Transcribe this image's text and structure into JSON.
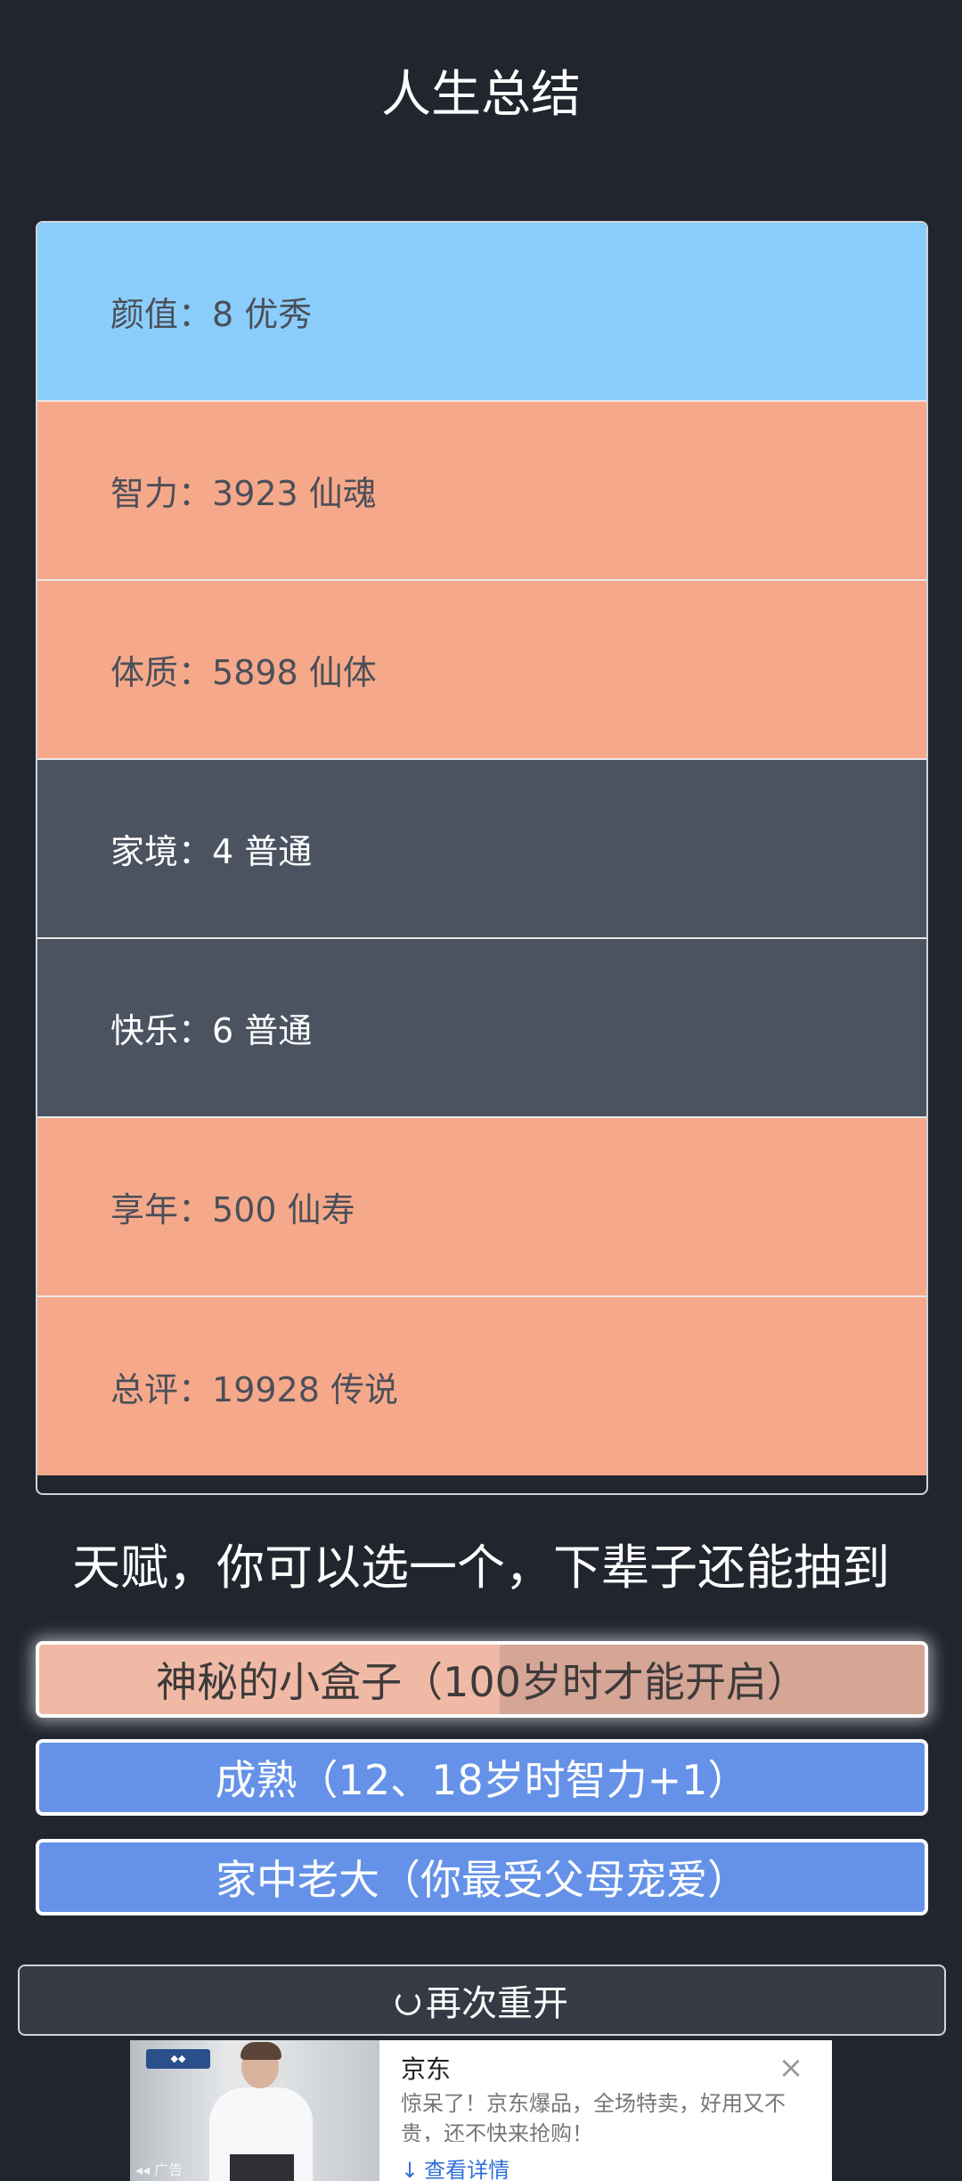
{
  "title": "人生总结",
  "summary": [
    {
      "label": "颜值：",
      "value": "8 优秀",
      "color": "#8bcdfa"
    },
    {
      "label": "智力：",
      "value": "3923 仙魂",
      "color": "#f6a98a"
    },
    {
      "label": "体质：",
      "value": "5898 仙体",
      "color": "#f6a98a"
    },
    {
      "label": "家境：",
      "value": "4 普通",
      "color": "#4b5361"
    },
    {
      "label": "快乐：",
      "value": "6 普通",
      "color": "#4b5361"
    },
    {
      "label": "享年：",
      "value": "500 仙寿",
      "color": "#f6a98a"
    },
    {
      "label": "总评：",
      "value": "19928 传说",
      "color": "#f6a98a"
    }
  ],
  "talent_heading": "天赋，你可以选一个，下辈子还能抽到",
  "talents": [
    {
      "label": "神秘的小盒子（100岁时才能开启）",
      "selected": true
    },
    {
      "label": "成熟（12、18岁时智力+1）",
      "selected": false
    },
    {
      "label": "家中老大（你最受父母宠爱）",
      "selected": false
    }
  ],
  "restart_label": "再次重开",
  "ad": {
    "tag": "广告",
    "brand": "京东",
    "description": "惊呆了！京东爆品，全场特卖，好用又不贵，还不快来抢购！",
    "more_label": "查看详情",
    "close_icon": "close-icon"
  }
}
